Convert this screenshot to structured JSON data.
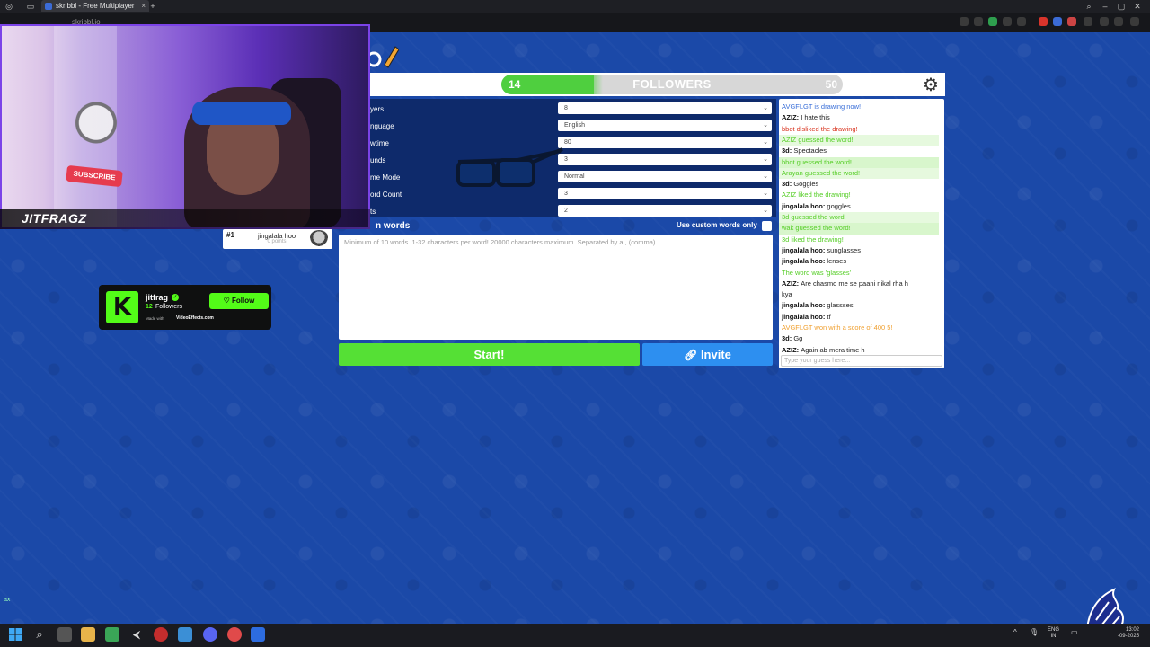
{
  "browser": {
    "tab_title": "skribbl - Free Multiplayer",
    "url": "skribbl.io",
    "tab_close": "×",
    "new_tab": "+"
  },
  "followers_bar": {
    "start": "14",
    "label": "FOLLOWERS",
    "end": "50",
    "progress_fraction": 0.27
  },
  "settings": {
    "rows": [
      {
        "label": "yers",
        "value": "8"
      },
      {
        "label": "nguage",
        "value": "English"
      },
      {
        "label": "wtime",
        "value": "80"
      },
      {
        "label": "unds",
        "value": "3"
      },
      {
        "label": "me Mode",
        "value": "Normal"
      },
      {
        "label": "ord Count",
        "value": "3"
      },
      {
        "label": "ts",
        "value": "2"
      }
    ],
    "custom_words_title": "n words",
    "custom_words_option": "Use custom words only",
    "custom_words_placeholder": "Minimum of 10 words. 1-32 characters per word! 20000 characters maximum. Separated by a , (comma)",
    "start_label": "Start!",
    "invite_label": "Invite"
  },
  "chat": {
    "messages": [
      {
        "author": "",
        "text": "AVGFLGT is drawing now!",
        "color": "#3a6fd8"
      },
      {
        "author": "AZIZ:",
        "text": "I hate this",
        "color": "#222222"
      },
      {
        "author": "",
        "text": "bbot disliked the drawing!",
        "color": "#d9341f"
      },
      {
        "author": "",
        "text": "AZIZ guessed the word!",
        "color": "#56ce27",
        "bg": "#e6f9de"
      },
      {
        "author": "3d:",
        "text": "Spectacles",
        "color": "#222222"
      },
      {
        "author": "",
        "text": "bbot guessed the word!",
        "color": "#56ce27",
        "bg": "#d8f6cc"
      },
      {
        "author": "",
        "text": "Arayan guessed the word!",
        "color": "#56ce27",
        "bg": "#e6f9de"
      },
      {
        "author": "3d:",
        "text": "Goggles",
        "color": "#222222"
      },
      {
        "author": "",
        "text": "AZIZ liked the drawing!",
        "color": "#56ce27"
      },
      {
        "author": "jingalala hoo:",
        "text": "goggles",
        "color": "#222222"
      },
      {
        "author": "",
        "text": "3d guessed the word!",
        "color": "#56ce27",
        "bg": "#e6f9de"
      },
      {
        "author": "",
        "text": "wak guessed the word!",
        "color": "#56ce27",
        "bg": "#d8f6cc"
      },
      {
        "author": "",
        "text": "3d liked the drawing!",
        "color": "#56ce27"
      },
      {
        "author": "jingalala hoo:",
        "text": "sunglasses",
        "color": "#222222"
      },
      {
        "author": "jingalala hoo:",
        "text": "lenses",
        "color": "#222222"
      },
      {
        "author": "",
        "text": "The word was 'glasses'",
        "color": "#56ce27"
      },
      {
        "author": "AZIZ:",
        "text": "Are chasmo me se paani nikal rha h",
        "color": "#222222"
      },
      {
        "author": "",
        "text": "kya",
        "color": "#222222"
      },
      {
        "author": "jingalala hoo:",
        "text": "glassses",
        "color": "#222222"
      },
      {
        "author": "jingalala hoo:",
        "text": "tf",
        "color": "#222222"
      },
      {
        "author": "",
        "text": "AVGFLGT won with a score of 400 5!",
        "color": "#f0a030"
      },
      {
        "author": "3d:",
        "text": "Gg",
        "color": "#222222"
      },
      {
        "author": "AZIZ:",
        "text": "Again ab mera time h",
        "color": "#222222"
      }
    ],
    "input_placeholder": "Type your guess here..."
  },
  "webcam": {
    "streamer_name": "JITFRAGZ",
    "poster_text": "SUBSCRIBE"
  },
  "player_card": {
    "rank": "#1",
    "name": "jingalala hoo",
    "points": "0 points"
  },
  "kick_widget": {
    "logo": "K",
    "name": "jitfrag",
    "verified": "✓",
    "followers_count": "12",
    "followers_label": "Followers",
    "made_with": "Made with",
    "brand": "VideoEffects.com",
    "follow_label": "♡ Follow"
  },
  "taskbar": {
    "lang": "ENG\nIN",
    "time": "13:02\n-09-2025",
    "tray": "^",
    "ax": "ax"
  },
  "icons": [
    "gear-icon",
    "link-icon",
    "pencil-icon",
    "windows-start-icon",
    "search-icon",
    "file-explorer-icon"
  ]
}
